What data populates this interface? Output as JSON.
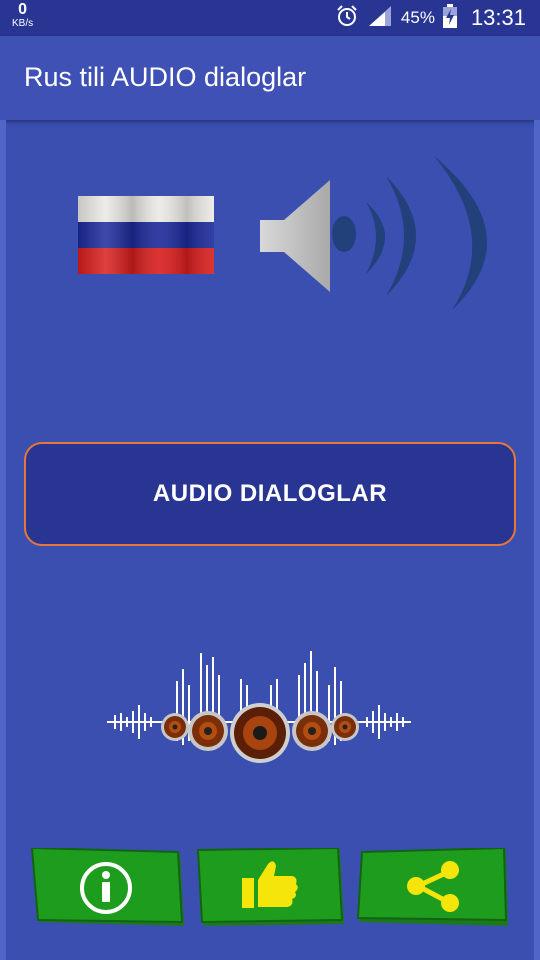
{
  "status_bar": {
    "net_speed_value": "0",
    "net_speed_unit": "KB/s",
    "battery_percent": "45%",
    "time": "13:31"
  },
  "app_bar": {
    "title": "Rus tili AUDIO dialoglar"
  },
  "main": {
    "audio_button_label": "AUDIO DIALOGLAR"
  },
  "bottom_bar": {
    "buttons": [
      "info",
      "like",
      "share"
    ]
  },
  "colors": {
    "background": "#3a4fb0",
    "status_bar": "#283593",
    "app_bar": "#3f51b5",
    "button_border": "#e8763a",
    "green_button": "#1e8c1e",
    "like_yellow": "#f5e50a"
  }
}
